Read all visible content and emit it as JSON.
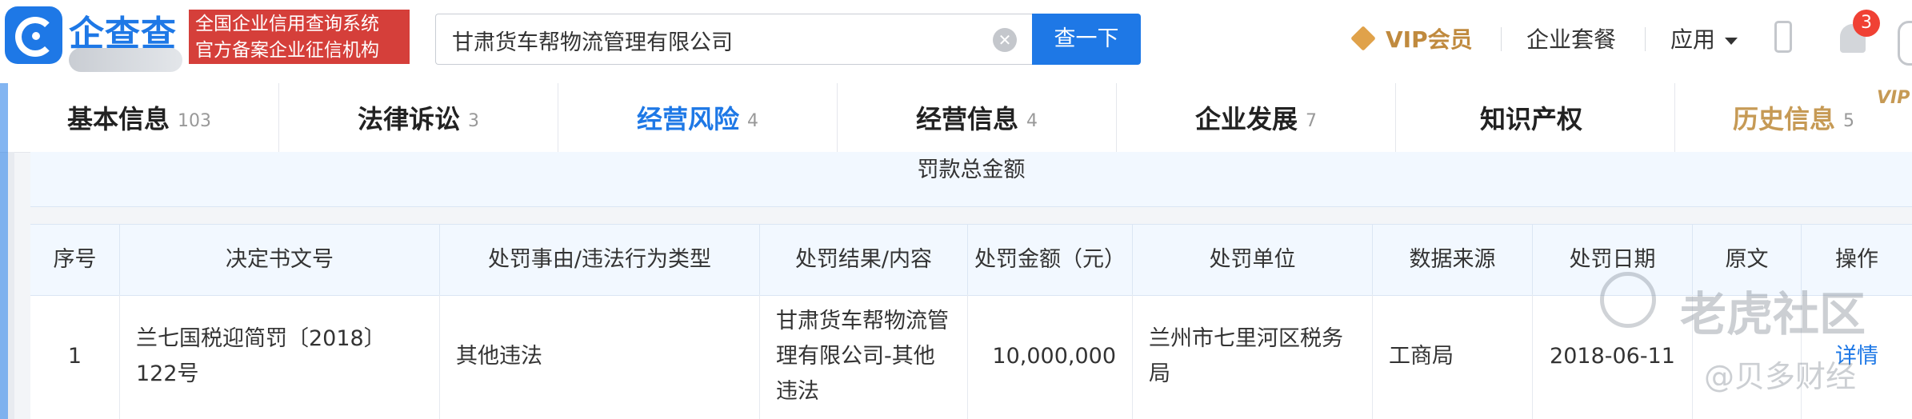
{
  "header": {
    "logo_text": "企查查",
    "slogan_line1": "全国企业信用查询系统",
    "slogan_line2": "官方备案企业征信机构",
    "search_value": "甘肃货车帮物流管理有限公司",
    "search_button": "查一下",
    "clear_icon": "✕",
    "vip_label": "VIP会员",
    "menu_package": "企业套餐",
    "menu_apps": "应用",
    "notification_count": "3"
  },
  "tabs": [
    {
      "label": "基本信息",
      "count": "103"
    },
    {
      "label": "法律诉讼",
      "count": "3"
    },
    {
      "label": "经营风险",
      "count": "4"
    },
    {
      "label": "经营信息",
      "count": "4"
    },
    {
      "label": "企业发展",
      "count": "7"
    },
    {
      "label": "知识产权",
      "count": ""
    },
    {
      "label": "历史信息",
      "count": "5"
    }
  ],
  "vip_tag": "VIP",
  "fine_total_label": "罚款总金额",
  "table": {
    "headers": [
      "序号",
      "决定书文号",
      "处罚事由/违法行为类型",
      "处罚结果/内容",
      "处罚金额（元）",
      "处罚单位",
      "数据来源",
      "处罚日期",
      "原文",
      "操作"
    ],
    "rows": [
      {
        "index": "1",
        "decision_no": "兰七国税迎简罚〔2018〕122号",
        "reason": "其他违法",
        "result": "甘肃货车帮物流管理有限公司-其他违法",
        "amount": "10,000,000",
        "unit": "兰州市七里河区税务局",
        "source": "工商局",
        "date": "2018-06-11",
        "original": "",
        "action": "详情"
      }
    ]
  },
  "watermark": {
    "line1": "老虎社区",
    "line2": "@贝多财经"
  }
}
